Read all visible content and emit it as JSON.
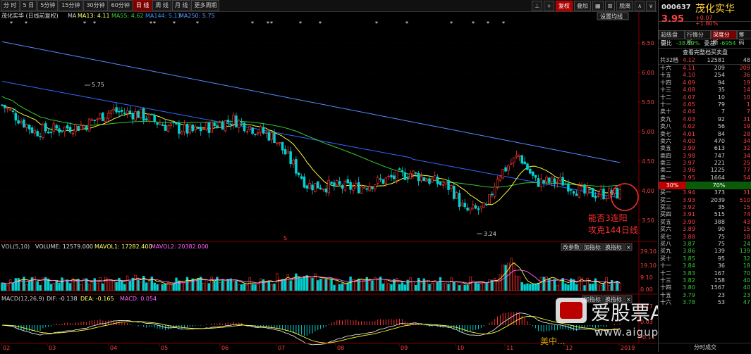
{
  "toolbar": {
    "tabs": [
      "分 时",
      "5 日",
      "5分钟",
      "15分钟",
      "30分钟",
      "60分钟",
      "日 线",
      "周 线",
      "月 线",
      "更多周期"
    ],
    "active_tab": "日 线",
    "right": [
      "⊥",
      "+",
      "复权",
      "叠加",
      "▦",
      "⊞",
      "脱离",
      "∧",
      "∨"
    ]
  },
  "chart": {
    "stock_label": "茂化实华 (日线前复权)",
    "ma_label": "MA",
    "ma13": "MA13: 4.11",
    "ma55": "MA55: 4.62",
    "ma144": "MA144: 5.11",
    "ma250": "MA250: 5.75",
    "ma_setting": "设置均线",
    "price_ticks": [
      "6.50",
      "6.00",
      "5.50",
      "5.00",
      "4.50",
      "4.00",
      "3.50"
    ],
    "high_label": "5.75",
    "low_label": "3.24",
    "annotation_line1": "能否3连阳",
    "annotation_line2": "攻克144日线",
    "vol_label": "VOL(5,10)",
    "volume": "VOLUME: 12579.000",
    "mavol1": "MAVOL1: 17282.400",
    "mavol2": "MAVOL2: 20382.000",
    "vol_ticks": [
      "29.10",
      "19.10",
      "9.10",
      "0.00"
    ],
    "vol_buttons": [
      "改参数",
      "加指标",
      "换指标",
      "×"
    ],
    "macd_label": "MACD(12,26,9)",
    "dif": "DIF: -0.138",
    "dea": "DEA: -0.165",
    "macd": "MACD: 0.054",
    "macd_buttons": [
      "加指标",
      "换指标",
      "×"
    ],
    "macd_ticks": [
      "0.17",
      "0.03",
      "-0.11"
    ],
    "x_ticks": [
      "02",
      "03",
      "04",
      "05",
      "06",
      "07",
      "08",
      "09",
      "10",
      "11",
      "12",
      "2019"
    ],
    "s_mark": "S"
  },
  "panel": {
    "code": "000637",
    "name": "茂化实华",
    "price": "3.95",
    "change": "+0.07",
    "change_pct": "+1.80%",
    "tabs": [
      "超级盘口",
      "行情分析",
      "深度分析",
      "筹码"
    ],
    "active_tab": "深度分析",
    "ratio_label": "委比",
    "ratio_value": "-38.19%",
    "diff_label": "委差",
    "diff_value": "-6954",
    "view_full": "查看完整档买卖盘",
    "total_label": "共32档",
    "total_price": "4.12",
    "total_vol": "12581",
    "total_ex": "48",
    "asks": [
      {
        "label": "十六",
        "price": "4.11",
        "vol": "209",
        "ex": "209"
      },
      {
        "label": "十五",
        "price": "4.10",
        "vol": "254",
        "ex": "36"
      },
      {
        "label": "十四",
        "price": "4.09",
        "vol": "94",
        "ex": "19"
      },
      {
        "label": "十三",
        "price": "4.08",
        "vol": "35",
        "ex": "14"
      },
      {
        "label": "十二",
        "price": "4.07",
        "vol": "10",
        "ex": "10"
      },
      {
        "label": "十一",
        "price": "4.05",
        "vol": "79",
        "ex": "1"
      },
      {
        "label": "卖十",
        "price": "4.04",
        "vol": "7",
        "ex": "7"
      },
      {
        "label": "卖九",
        "price": "4.03",
        "vol": "92",
        "ex": "31"
      },
      {
        "label": "卖八",
        "price": "4.02",
        "vol": "56",
        "ex": "19"
      },
      {
        "label": "卖七",
        "price": "4.01",
        "vol": "84",
        "ex": "28"
      },
      {
        "label": "卖六",
        "price": "4.00",
        "vol": "470",
        "ex": "34"
      },
      {
        "label": "卖五",
        "price": "3.99",
        "vol": "613",
        "ex": "32"
      },
      {
        "label": "卖四",
        "price": "3.98",
        "vol": "747",
        "ex": "34"
      },
      {
        "label": "卖三",
        "price": "3.97",
        "vol": "221",
        "ex": "25"
      },
      {
        "label": "卖二",
        "price": "3.96",
        "vol": "1225",
        "ex": "77"
      },
      {
        "label": "卖一",
        "price": "3.95",
        "vol": "1664",
        "ex": "54"
      }
    ],
    "split_red": "30%",
    "split_green": "70%",
    "bids": [
      {
        "label": "买一",
        "price": "3.94",
        "vol": "373",
        "ex": "31"
      },
      {
        "label": "买二",
        "price": "3.93",
        "vol": "2039",
        "ex": "510"
      },
      {
        "label": "买三",
        "price": "3.92",
        "vol": "35",
        "ex": "15"
      },
      {
        "label": "买四",
        "price": "3.91",
        "vol": "515",
        "ex": "74"
      },
      {
        "label": "买五",
        "price": "3.90",
        "vol": "388",
        "ex": "43"
      },
      {
        "label": "买六",
        "price": "3.89",
        "vol": "90",
        "ex": "15"
      },
      {
        "label": "买七",
        "price": "3.88",
        "vol": "75",
        "ex": "18"
      },
      {
        "label": "买八",
        "price": "3.87",
        "vol": "75",
        "ex": "24"
      },
      {
        "label": "买九",
        "price": "3.86",
        "vol": "139",
        "ex": "139"
      },
      {
        "label": "买十",
        "price": "3.85",
        "vol": "95",
        "ex": "32"
      },
      {
        "label": "十一",
        "price": "3.84",
        "vol": "36",
        "ex": "18"
      },
      {
        "label": "十二",
        "price": "3.83",
        "vol": "167",
        "ex": "70"
      },
      {
        "label": "十三",
        "price": "3.82",
        "vol": "158",
        "ex": "40"
      },
      {
        "label": "十四",
        "price": "3.80",
        "vol": "1567",
        "ex": "40"
      },
      {
        "label": "十五",
        "price": "3.79",
        "vol": "23",
        "ex": "23"
      },
      {
        "label": "十六",
        "price": "3.78",
        "vol": "53",
        "ex": "47"
      }
    ],
    "footer": "分时成交"
  },
  "watermark": {
    "title": "爱股票APP",
    "url": "www.aigupiao.com",
    "caption": "美中..."
  }
}
